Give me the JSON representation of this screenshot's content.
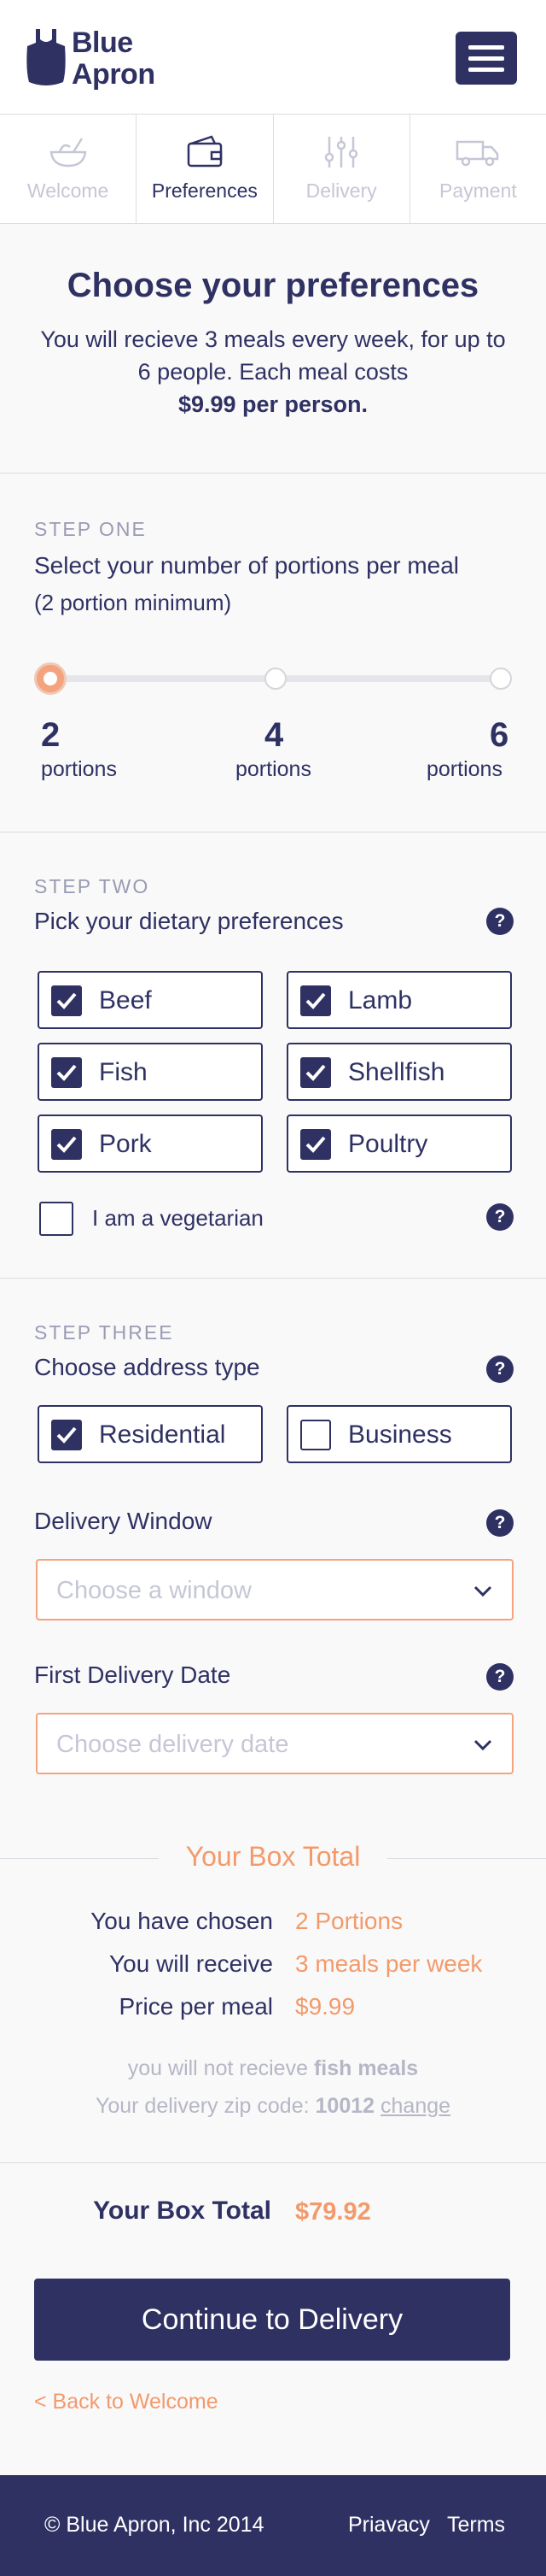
{
  "brand": {
    "name_line1": "Blue",
    "name_line2": "Apron"
  },
  "tabs": [
    {
      "label": "Welcome",
      "icon": "bowl-icon",
      "active": false
    },
    {
      "label": "Preferences",
      "icon": "wallet-icon",
      "active": true
    },
    {
      "label": "Delivery",
      "icon": "sliders-icon",
      "active": false
    },
    {
      "label": "Payment",
      "icon": "truck-icon",
      "active": false
    }
  ],
  "intro": {
    "title": "Choose your preferences",
    "body": "You will recieve 3 meals every week, for up to 6 people. Each meal costs",
    "price": "$9.99 per person."
  },
  "step1": {
    "label": "STEP ONE",
    "title": "Select your number of portions per meal",
    "subtitle": "(2 portion minimum)",
    "selected": 2,
    "options": [
      {
        "num": "2",
        "unit": "portions"
      },
      {
        "num": "4",
        "unit": "portions"
      },
      {
        "num": "6",
        "unit": "portions"
      }
    ]
  },
  "step2": {
    "label": "STEP TWO",
    "title": "Pick your dietary preferences",
    "help": "?",
    "options": [
      {
        "label": "Beef",
        "checked": true
      },
      {
        "label": "Lamb",
        "checked": true
      },
      {
        "label": "Fish",
        "checked": true
      },
      {
        "label": "Shellfish",
        "checked": true
      },
      {
        "label": "Pork",
        "checked": true
      },
      {
        "label": "Poultry",
        "checked": true
      }
    ],
    "vegetarian_label": "I am a vegetarian"
  },
  "step3": {
    "label": "STEP THREE",
    "title": "Choose address type",
    "help": "?",
    "residential": "Residential",
    "business": "Business",
    "delivery_window_label": "Delivery Window",
    "delivery_window_placeholder": "Choose a window",
    "first_date_label": "First Delivery Date",
    "first_date_placeholder": "Choose delivery date"
  },
  "totals": {
    "title": "Your Box Total",
    "chosen_label": "You have chosen",
    "chosen_value": "2 Portions",
    "receive_label": "You will receive",
    "receive_value": "3 meals per week",
    "price_label": "Price per meal",
    "price_value": "$9.99",
    "note_prefix": "you will not recieve",
    "note_bold": "fish meals",
    "zip_prefix": "Your delivery zip code:",
    "zip_value": "10012",
    "zip_change": "change",
    "box_total_label": "Your Box Total",
    "box_total_value": "$79.92"
  },
  "actions": {
    "continue": "Continue to Delivery",
    "back": "< Back to Welcome"
  },
  "footer": {
    "copyright": "© Blue Apron, Inc 2014",
    "privacy": "Priavacy",
    "terms": "Terms"
  },
  "colors": {
    "navy": "#2f3163",
    "accent": "#f39a6b"
  }
}
